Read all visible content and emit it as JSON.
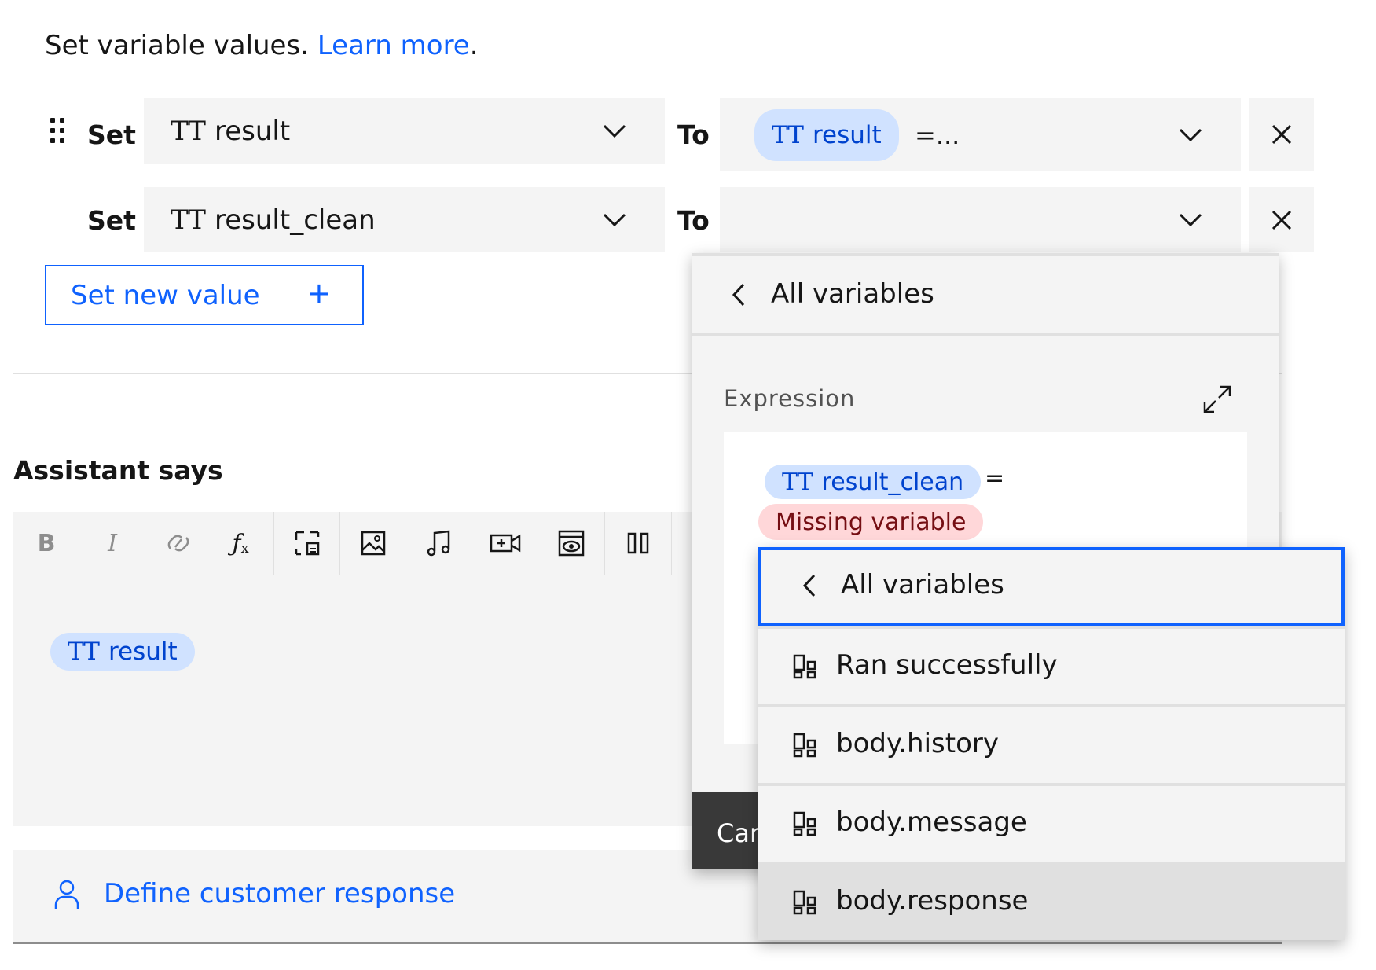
{
  "intro": {
    "text": "Set variable values. ",
    "link": "Learn more",
    "period": "."
  },
  "rows": [
    {
      "set_label": "Set",
      "variable": "result",
      "to_label": "To",
      "value_tag": "result",
      "value_suffix": "=..."
    },
    {
      "set_label": "Set",
      "variable": "result_clean",
      "to_label": "To",
      "value_tag": "",
      "value_suffix": ""
    }
  ],
  "type_glyph": "TT",
  "set_new_value": {
    "label": "Set new value",
    "icon": "+"
  },
  "assistant": {
    "title": "Assistant says",
    "toolbar": [
      "bold-icon",
      "italic-icon",
      "link-icon",
      "function-icon",
      "dynamic-image-icon",
      "image-icon",
      "audio-icon",
      "video-icon",
      "iframe-icon",
      "columns-icon"
    ],
    "bold_glyph": "B",
    "italic_glyph": "I",
    "content_tag": "result"
  },
  "customer_response": {
    "label": "Define customer response"
  },
  "panel": {
    "header": "All variables",
    "expression_label": "Expression",
    "expression_var": "result_clean",
    "expression_op": "=",
    "missing": "Missing variable",
    "cancel_label": "Car"
  },
  "dropdown": {
    "header": "All variables",
    "items": [
      "Ran successfully",
      "body.history",
      "body.message",
      "body.response"
    ],
    "selected_index": 3
  },
  "colors": {
    "link": "#0f62fe",
    "tag_bg": "#d0e2ff",
    "tag_fg": "#0043ce",
    "error_bg": "#ffd7d9",
    "error_fg": "#750e13",
    "field_bg": "#f4f4f4"
  }
}
